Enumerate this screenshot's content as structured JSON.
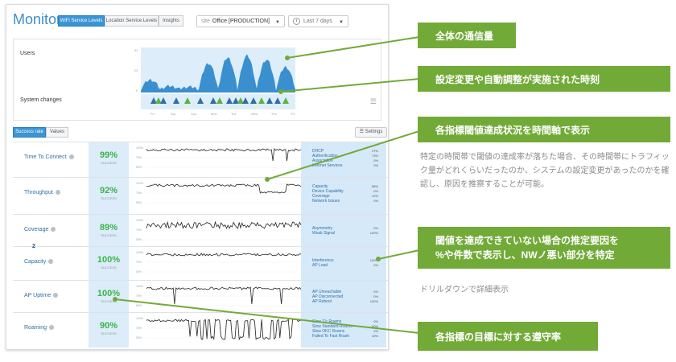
{
  "header": {
    "title": "Monitor",
    "tabs": [
      "WiFi Service Levels",
      "Location Service Levels",
      "Insights"
    ],
    "site_label": "site",
    "site_value": "Office [PRODUCTION]",
    "date_range": "Last 7 days"
  },
  "overview": {
    "users_label": "Users",
    "system_changes_label": "System changes",
    "days": [
      "Fri",
      "Sat",
      "Sun",
      "Mon",
      "Tue",
      "Wed",
      "Thu",
      "Fri"
    ],
    "y_axis": [
      "50",
      "25",
      "0"
    ]
  },
  "view_tabs": [
    "Success rate",
    "Values"
  ],
  "settings_label": "Settings",
  "metrics": [
    {
      "name": "Time To Connect",
      "rate": "99%",
      "sub": "SUCCESS",
      "reasons": [
        {
          "label": "DHCP",
          "pct": "27%"
        },
        {
          "label": "Authentication",
          "pct": "73%"
        },
        {
          "label": "Association",
          "pct": "0%"
        },
        {
          "label": "Internet Services",
          "pct": "0%"
        }
      ]
    },
    {
      "name": "Throughput",
      "rate": "92%",
      "sub": "SUCCESS",
      "reasons": [
        {
          "label": "Capacity",
          "pct": "88%"
        },
        {
          "label": "Device Capability",
          "pct": "0%"
        },
        {
          "label": "Coverage",
          "pct": "12%"
        },
        {
          "label": "Network Issues",
          "pct": "0%"
        }
      ]
    },
    {
      "name": "Coverage",
      "rate": "89%",
      "sub": "SUCCESS",
      "reasons": [
        {
          "label": "Asymmetry",
          "pct": "0%"
        },
        {
          "label": "Weak Signal",
          "pct": "100%"
        }
      ]
    },
    {
      "name": "Capacity",
      "rate": "100%",
      "sub": "SUCCESS",
      "reasons": [
        {
          "label": "Interference",
          "pct": "100%"
        },
        {
          "label": "AP Load",
          "pct": "0%"
        }
      ]
    },
    {
      "name": "AP Uptime",
      "rate": "100%",
      "sub": "SUCCESS",
      "reasons": [
        {
          "label": "AP Unreachable",
          "pct": "0%"
        },
        {
          "label": "AP Disconnected",
          "pct": "0%"
        },
        {
          "label": "AP Reboot",
          "pct": "100%"
        }
      ]
    },
    {
      "name": "Roaming",
      "rate": "90%",
      "sub": "SUCCESS",
      "reasons": [
        {
          "label": "Slow 11r Roams",
          "pct": "0%"
        },
        {
          "label": "Slow Standard Roams",
          "pct": "60%"
        },
        {
          "label": "Slow OKC Roams",
          "pct": "0%"
        },
        {
          "label": "Failed To Fast Roam",
          "pct": "40%"
        }
      ]
    }
  ],
  "badge_number": "2",
  "annotations": {
    "callout1": "全体の通信量",
    "callout2": "設定変更や自動調整が実施された時刻",
    "callout3": "各指標閾値達成状況を時間軸で表示",
    "note3": "特定の時間帯で閾値の達成率が落ちた場合、その時間帯にトラフィック量がどれくらいだったのか、システムの設定変更があったのかを確認し、原因を推察することが可能。",
    "callout4_line1": "閾値を達成できていない場合の推定要因を",
    "callout4_line2": "%や件数で表示し、NWノ悪い部分を特定",
    "note4": "ドリルダウンで詳細表示",
    "callout5": "各指標の目標に対する遵守率"
  },
  "colors": {
    "accent_blue": "#3b95d4",
    "success_green": "#39b54a",
    "callout_green": "#72aa38",
    "triangle_blue": "#2f6fa5"
  }
}
